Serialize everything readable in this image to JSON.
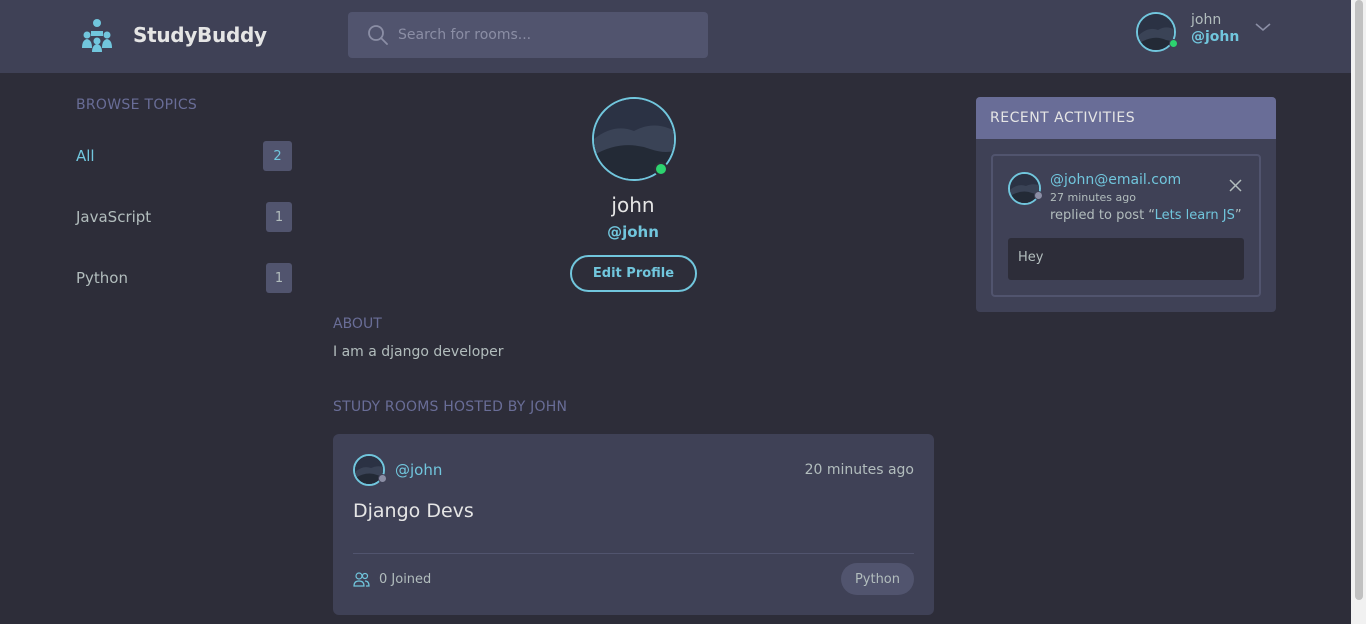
{
  "header": {
    "app_name": "StudyBuddy",
    "search_placeholder": "Search for rooms...",
    "user": {
      "name": "john",
      "handle": "@john",
      "online": true
    }
  },
  "sidebar": {
    "title": "BROWSE TOPICS",
    "topics": [
      {
        "label": "All",
        "count": "2",
        "active": true
      },
      {
        "label": "JavaScript",
        "count": "1",
        "active": false
      },
      {
        "label": "Python",
        "count": "1",
        "active": false
      }
    ]
  },
  "profile": {
    "name": "john",
    "handle": "@john",
    "edit_label": "Edit Profile",
    "about_title": "ABOUT",
    "about_text": "I am a django developer",
    "rooms_title": "STUDY ROOMS HOSTED BY JOHN"
  },
  "rooms": [
    {
      "host": "@john",
      "time": "20 minutes ago",
      "name": "Django Devs",
      "joined": "0 Joined",
      "topic": "Python"
    }
  ],
  "activity": {
    "title": "RECENT ACTIVITIES",
    "items": [
      {
        "user": "@john@email.com",
        "time": "27 minutes ago",
        "action_prefix": "replied to post “",
        "post_title": "Lets learn JS",
        "action_suffix": "”",
        "message": "Hey"
      }
    ]
  },
  "colors": {
    "background": "#2d2d39",
    "header": "#3f4156",
    "accent": "#71c6dd",
    "muted_heading": "#696d97",
    "online": "#2dd36f"
  },
  "icons": [
    "logo-icon",
    "search-icon",
    "chevron-down-icon",
    "users-icon",
    "close-icon"
  ]
}
